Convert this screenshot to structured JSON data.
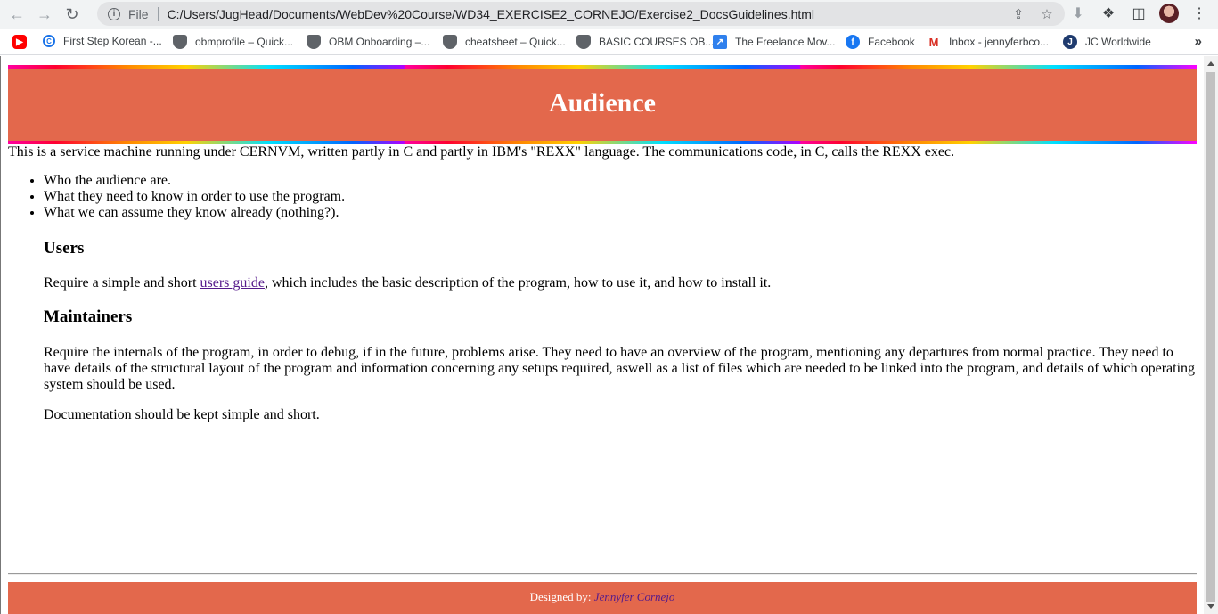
{
  "browser": {
    "file_label": "File",
    "url": "C:/Users/JugHead/Documents/WebDev%20Course/WD34_EXERCISE2_CORNEJO/Exercise2_DocsGuidelines.html",
    "bookmarks": [
      {
        "label": "First Step Korean -...",
        "icon": "coursera-icon"
      },
      {
        "label": "obmprofile – Quick...",
        "icon": "shield-icon"
      },
      {
        "label": "OBM Onboarding –...",
        "icon": "shield-icon"
      },
      {
        "label": "cheatsheet – Quick...",
        "icon": "shield-icon"
      },
      {
        "label": "BASIC COURSES OB...",
        "icon": "shield-icon"
      },
      {
        "label": "The Freelance Mov...",
        "icon": "freelance-icon"
      },
      {
        "label": "Facebook",
        "icon": "facebook-icon"
      },
      {
        "label": "Inbox - jennyferbco...",
        "icon": "gmail-icon"
      },
      {
        "label": "JC Worldwide",
        "icon": "jc-icon"
      }
    ],
    "more_glyph": "»"
  },
  "page": {
    "title": "Audience",
    "intro": "This is a service machine running under CERNVM, written partly in C and partly in IBM's \"REXX\" language. The communications code, in C, calls the REXX exec.",
    "points": [
      "Who the audience are.",
      "What they need to know in order to use the program.",
      "What we can assume they know already (nothing?)."
    ],
    "users": {
      "heading": "Users",
      "text_before": "Require a simple and short ",
      "link": "users guide",
      "text_after": ", which includes the basic description of the program, how to use it, and how to install it."
    },
    "maintainers": {
      "heading": "Maintainers",
      "text": "Require the internals of the program, in order to debug, if in the future, problems arise. They need to have an overview of the program, mentioning any departures from normal practice. They need to have details of the structural layout of the program and information concerning any setups required, aswell as a list of files which are needed to be linked into the program, and details of which operating system should be used.",
      "closing": "Documentation should be kept simple and short."
    },
    "footer": {
      "prefix": "Designed by: ",
      "author": "Jennyfer Cornejo"
    }
  },
  "colors": {
    "header_bg": "#e3684c",
    "link": "#551a8b"
  }
}
